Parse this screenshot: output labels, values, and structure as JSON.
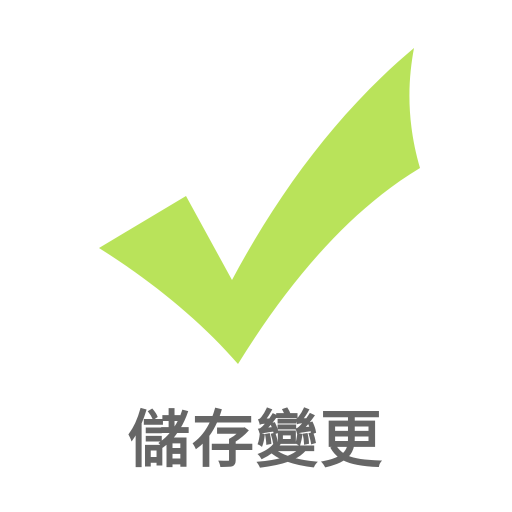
{
  "save": {
    "label": "儲存變更",
    "icon": "check-icon"
  },
  "colors": {
    "check": "#b9e35a",
    "label": "#666666",
    "background": "#ffffff"
  }
}
